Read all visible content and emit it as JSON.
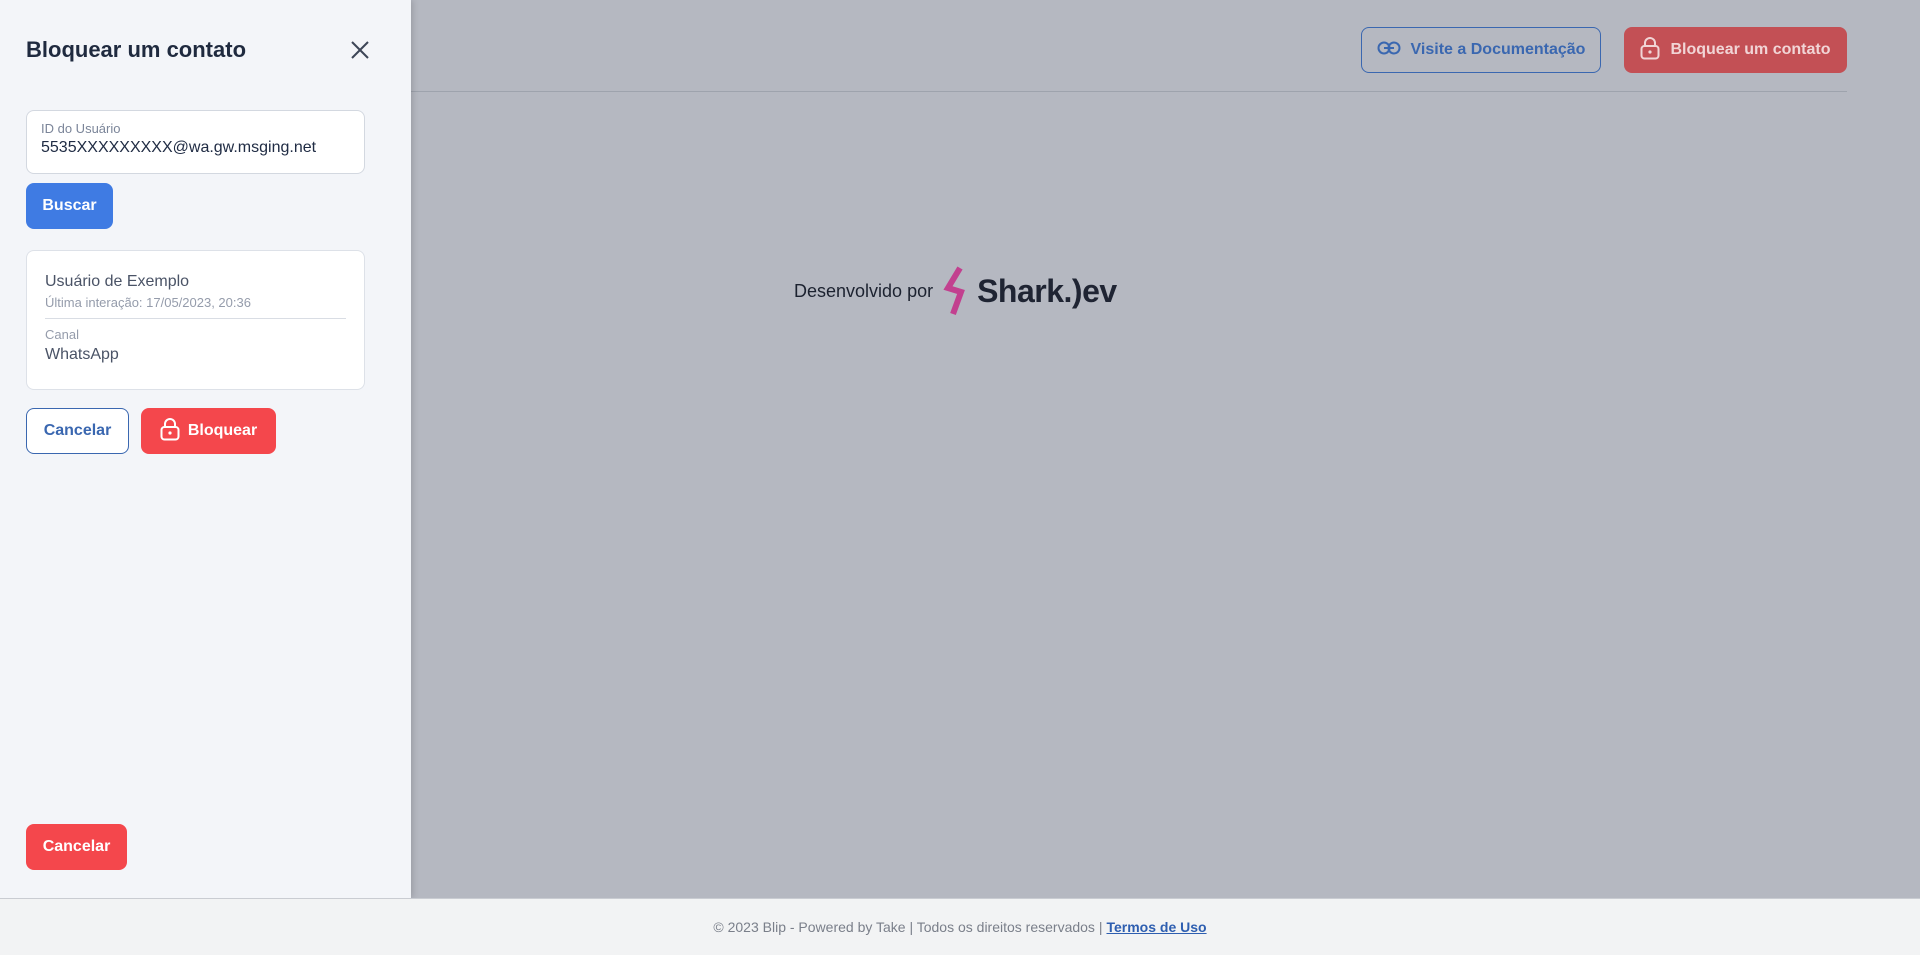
{
  "header": {
    "doc_button_label": "Visite a Documentação",
    "block_button_label": "Bloquear um contato"
  },
  "credit": {
    "text": "Desenvolvido por",
    "brand": "Shark.)ev"
  },
  "panel": {
    "title": "Bloquear um contato",
    "user_id_label": "ID do Usuário",
    "user_id_value": "5535XXXXXXXXX@wa.gw.msging.net",
    "search_button": "Buscar",
    "result": {
      "name": "Usuário de Exemplo",
      "last_interaction": "Última interação: 17/05/2023, 20:36",
      "channel_label": "Canal",
      "channel_value": "WhatsApp"
    },
    "cancel_button": "Cancelar",
    "block_button": "Bloquear",
    "bottom_cancel_button": "Cancelar"
  },
  "footer": {
    "text": "© 2023 Blip - Powered by Take | Todos os direitos reservados |",
    "terms_link": "Termos de Uso"
  },
  "colors": {
    "primary_blue": "#3f7be3",
    "outline_blue": "#3a67b0",
    "danger_red": "#f4474c",
    "brand_magenta": "#c2408f"
  }
}
